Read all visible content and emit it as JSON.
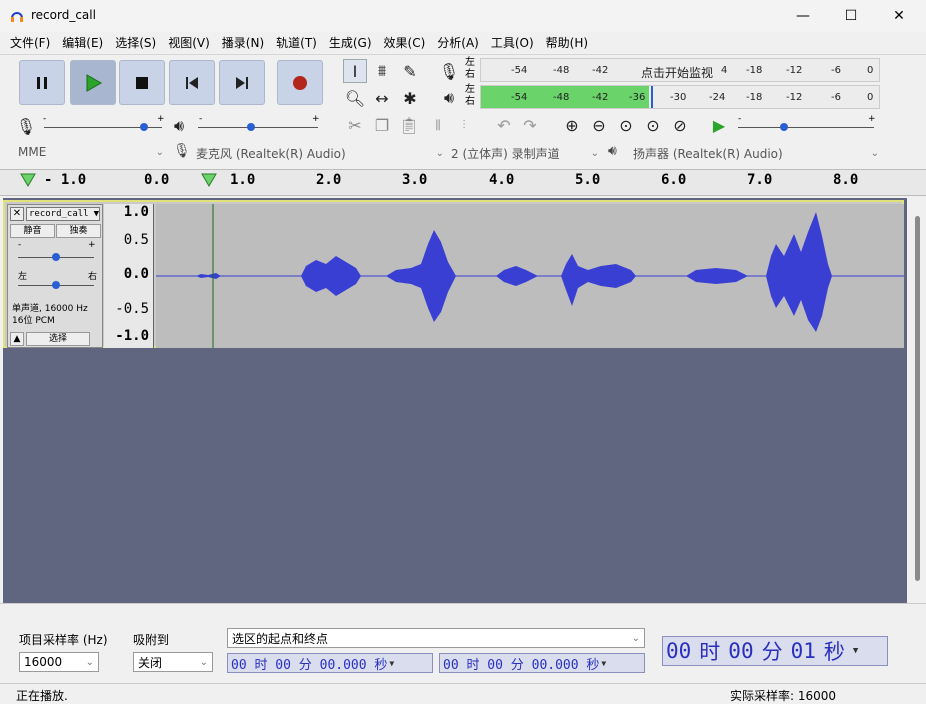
{
  "window": {
    "title": "record_call"
  },
  "menu": [
    "文件(F)",
    "编辑(E)",
    "选择(S)",
    "视图(V)",
    "播录(N)",
    "轨道(T)",
    "生成(G)",
    "效果(C)",
    "分析(A)",
    "工具(O)",
    "帮助(H)"
  ],
  "meters": {
    "record_lr": "左右",
    "play_lr": "左右",
    "record_scale": [
      "-54",
      "-48",
      "-42",
      "点击开始监视",
      "4",
      "-18",
      "-12",
      "-6",
      "0"
    ],
    "play_scale": [
      "-54",
      "-48",
      "-42",
      "-36",
      "-30",
      "-24",
      "-18",
      "-12",
      "-6",
      "0"
    ]
  },
  "sliders": {
    "minus": "-",
    "plus": "+"
  },
  "devices": {
    "host": "MME",
    "input": "麦克风 (Realtek(R) Audio)",
    "channels": "2 (立体声) 录制声道",
    "output": "扬声器 (Realtek(R) Audio)"
  },
  "ruler": {
    "labels": [
      "- 1.0",
      "0.0",
      "1.0",
      "2.0",
      "3.0",
      "4.0",
      "5.0",
      "6.0",
      "7.0",
      "8.0"
    ]
  },
  "track": {
    "name": "record_call",
    "mute": "静音",
    "solo": "独奏",
    "pan_left": "左",
    "pan_right": "右",
    "info1": "单声道, 16000 Hz",
    "info2": "16位 PCM",
    "select": "选择",
    "scale": [
      "1.0",
      "0.5",
      "0.0",
      "-0.5",
      "-1.0"
    ]
  },
  "bottom": {
    "rate_label": "项目采样率 (Hz)",
    "rate_value": "16000",
    "snap_label": "吸附到",
    "snap_value": "关闭",
    "sel_label": "选区的起点和终点",
    "sel_start": "00 时 00 分 00.000 秒",
    "sel_end": "00 时 00 分 00.000 秒",
    "time": {
      "h": "00",
      "h_unit": "时",
      "m": "00",
      "m_unit": "分",
      "s": "01",
      "s_unit": "秒"
    }
  },
  "status": {
    "left": "正在播放.",
    "right": "实际采样率:  16000"
  },
  "colors": {
    "accent": "#3a3fd4",
    "record": "#b3261e",
    "play": "#2aa52a",
    "meter": "#6ad46a"
  }
}
